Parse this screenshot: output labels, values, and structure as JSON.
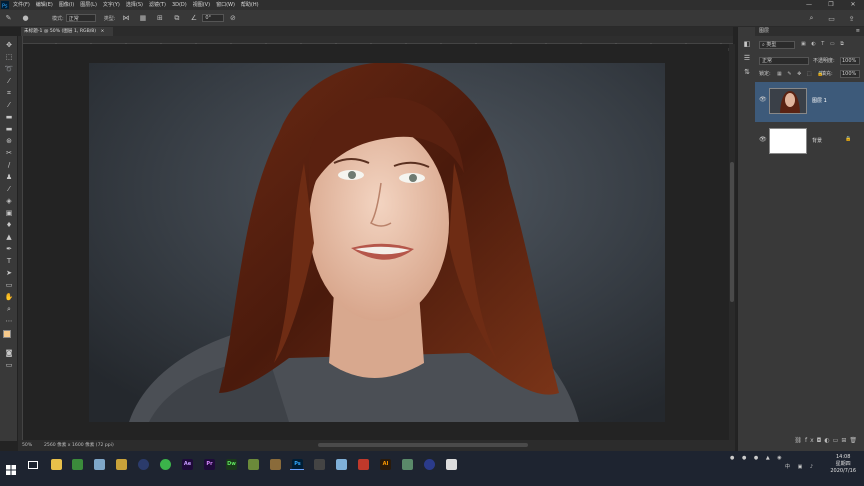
{
  "menubar": {
    "items": [
      "文件(F)",
      "编辑(E)",
      "图像(I)",
      "图层(L)",
      "文字(Y)",
      "选择(S)",
      "滤镜(T)",
      "3D(D)",
      "视图(V)",
      "窗口(W)",
      "帮助(H)"
    ],
    "window_controls": [
      "—",
      "❐",
      "✕"
    ]
  },
  "optbar": {
    "style_label": "模式:",
    "mode_value": "正常",
    "type_label": "类型:",
    "angle_value": "0°"
  },
  "document_tab": {
    "title": "未标题-1 @ 50% (图层 1, RGB/8)",
    "close": "×"
  },
  "statusbar": {
    "zoom": "50%",
    "doc_info": "2560 像素 x 1600 像素 (72 ppi)"
  },
  "layers_panel": {
    "title": "图层",
    "filter_label": "类型",
    "blend_mode": "正常",
    "opacity_label": "不透明度:",
    "opacity_value": "100%",
    "lock_label": "锁定:",
    "fill_label": "填充:",
    "fill_value": "100%",
    "layers": [
      {
        "name": "图层 1",
        "selected": true,
        "visible": true
      },
      {
        "name": "背景",
        "selected": false,
        "visible": true,
        "locked": true
      }
    ]
  },
  "taskbar": {
    "time": "14:08",
    "weekday": "星期四",
    "date": "2020/7/16",
    "app_labels": [
      "Ae",
      "Pr",
      "Dw",
      "Ps",
      "AI"
    ]
  },
  "colors": {
    "foreground": "#f6c98b",
    "background": "#ffffff",
    "accent": "#3d5a7a"
  }
}
